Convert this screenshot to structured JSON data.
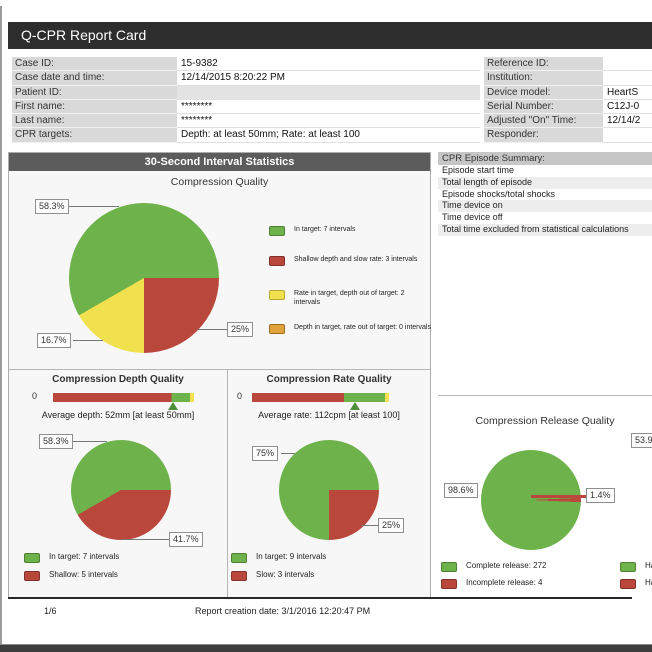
{
  "page": {
    "title": "Q-CPR Report Card",
    "footer_page": "1/6",
    "footer_note": "Report creation date: 3/1/2016 12:20:47 PM"
  },
  "case_info_left": {
    "rows": [
      {
        "label": "Case ID:",
        "value": "15-9382"
      },
      {
        "label": "Case date and time:",
        "value": "12/14/2015 8:20:22 PM"
      },
      {
        "label": "Patient ID:",
        "value": ""
      },
      {
        "label": "First name:",
        "value": "********"
      },
      {
        "label": "Last name:",
        "value": "********"
      },
      {
        "label": "CPR targets:",
        "value": "Depth: at least 50mm; Rate: at least 100"
      }
    ]
  },
  "case_info_right": {
    "rows": [
      {
        "label": "Reference ID:",
        "value": ""
      },
      {
        "label": "Institution:",
        "value": ""
      },
      {
        "label": "Device model:",
        "value": "HeartS"
      },
      {
        "label": "Serial Number:",
        "value": "C12J-0"
      },
      {
        "label": "Adjusted \"On\" Time:",
        "value": "12/14/2"
      },
      {
        "label": "Responder:",
        "value": ""
      }
    ]
  },
  "interval_section": {
    "header": "30-Second Interval Statistics"
  },
  "episode_summary": {
    "header": "CPR Episode Summary:",
    "rows": [
      "Episode start time",
      "Total length of episode",
      "Episode shocks/total shocks",
      "Time device on",
      "Time device off",
      "Total time excluded from statistical calculations"
    ]
  },
  "colors": {
    "green": "#6db24b",
    "red": "#b9473c",
    "yellow": "#f2e14e",
    "orange": "#e2a33c",
    "green_border": "#4f7f35",
    "red_border": "#81302a",
    "yellow_border": "#b5a737",
    "orange_border": "#9c6d1e"
  },
  "right_edge_truncated": {
    "pie_label": "53.9",
    "legend_items": [
      "Hand",
      "Hand"
    ]
  },
  "chart_data": [
    {
      "id": "compression_quality",
      "type": "pie",
      "title": "Compression Quality",
      "slices": [
        {
          "label": "In target: 7 intervals",
          "pct": 58.3,
          "color": "#6db24b",
          "border": "#4f7f35",
          "data_label": "58.3%"
        },
        {
          "label": "Shallow depth and slow rate: 3 intervals",
          "pct": 25,
          "color": "#b9473c",
          "border": "#81302a",
          "data_label": "25%"
        },
        {
          "label": "Rate in target, depth out of target: 2 intervals",
          "pct": 16.7,
          "color": "#f2e14e",
          "border": "#b5a737",
          "data_label": "16.7%"
        },
        {
          "label": "Depth in target, rate out of target: 0 intervals",
          "pct": 0,
          "color": "#e2a33c",
          "border": "#9c6d1e",
          "data_label": ""
        }
      ],
      "render": {
        "from_deg": 90,
        "segments": [
          {
            "color": "#b9473c",
            "pct": 25
          },
          {
            "color": "#f2e14e",
            "pct": 16.7
          },
          {
            "color": "#6db24b",
            "pct": 58.3
          }
        ]
      }
    },
    {
      "id": "compression_depth_bar",
      "type": "bar",
      "title": "Compression Depth Quality",
      "axis_start_label": "0",
      "caption": "Average depth: 52mm  [at least 50mm]",
      "segments": [
        {
          "color": "#b9473c",
          "pct": 84
        },
        {
          "color": "#6db24b",
          "pct": 13
        },
        {
          "color": "#f2e14e",
          "pct": 3
        }
      ],
      "marker_pct": 85
    },
    {
      "id": "compression_depth_pie",
      "type": "pie",
      "title": "",
      "slices": [
        {
          "label": "In target: 7 intervals",
          "pct": 58.3,
          "color": "#6db24b",
          "border": "#4f7f35",
          "data_label": "58.3%"
        },
        {
          "label": "Shallow: 5 intervals",
          "pct": 41.7,
          "color": "#b9473c",
          "border": "#81302a",
          "data_label": "41.7%"
        }
      ],
      "render": {
        "from_deg": 90,
        "segments": [
          {
            "color": "#b9473c",
            "pct": 41.7
          },
          {
            "color": "#6db24b",
            "pct": 58.3
          }
        ]
      }
    },
    {
      "id": "compression_rate_bar",
      "type": "bar",
      "title": "Compression Rate Quality",
      "axis_start_label": "0",
      "caption": "Average rate: 112cpm [at least 100]",
      "segments": [
        {
          "color": "#b9473c",
          "pct": 67
        },
        {
          "color": "#6db24b",
          "pct": 30
        },
        {
          "color": "#f2e14e",
          "pct": 3
        }
      ],
      "marker_pct": 75
    },
    {
      "id": "compression_rate_pie",
      "type": "pie",
      "title": "",
      "slices": [
        {
          "label": "In target: 9 intervals",
          "pct": 75,
          "color": "#6db24b",
          "border": "#4f7f35",
          "data_label": "75%"
        },
        {
          "label": "Slow: 3 intervals",
          "pct": 25,
          "color": "#b9473c",
          "border": "#81302a",
          "data_label": "25%"
        }
      ],
      "render": {
        "from_deg": 90,
        "segments": [
          {
            "color": "#b9473c",
            "pct": 25
          },
          {
            "color": "#6db24b",
            "pct": 75
          }
        ]
      }
    },
    {
      "id": "compression_release_pie",
      "type": "pie",
      "title": "Compression Release Quality",
      "slices": [
        {
          "label": "Complete release: 272",
          "pct": 98.6,
          "color": "#6db24b",
          "border": "#4f7f35",
          "data_label": "98.6%"
        },
        {
          "label": "Incomplete release: 4",
          "pct": 1.4,
          "color": "#b9473c",
          "border": "#81302a",
          "data_label": "1.4%"
        }
      ],
      "render": {
        "from_deg": 87.5,
        "segments": [
          {
            "color": "#b9473c",
            "pct": 1.4
          },
          {
            "color": "#6db24b",
            "pct": 98.6
          }
        ]
      }
    }
  ]
}
